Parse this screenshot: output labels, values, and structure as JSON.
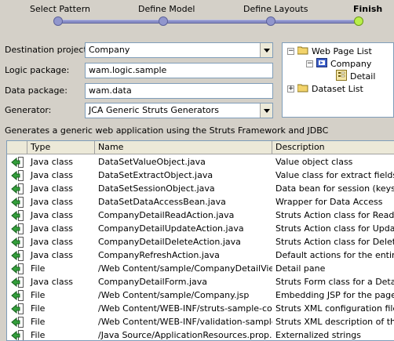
{
  "wizard": {
    "steps": [
      {
        "label": "Select Pattern"
      },
      {
        "label": "Define Model"
      },
      {
        "label": "Define Layouts"
      },
      {
        "label": "Finish"
      }
    ]
  },
  "form": {
    "destination_label": "Destination project:",
    "destination_value": "Company",
    "logic_label": "Logic package:",
    "logic_value": "wam.logic.sample",
    "data_label": "Data package:",
    "data_value": "wam.data",
    "generator_label": "Generator:",
    "generator_value": "JCA Generic Struts Generators"
  },
  "tree": {
    "items": [
      {
        "label": "Web Page List",
        "expander": "−"
      },
      {
        "label": "Company",
        "expander": "−"
      },
      {
        "label": "Detail",
        "expander": ""
      },
      {
        "label": "Dataset List",
        "expander": "+"
      }
    ]
  },
  "description": "Generates a generic web application using the Struts Framework and JDBC",
  "table": {
    "headers": [
      "Type",
      "Name",
      "Description"
    ],
    "rows": [
      {
        "type": "Java class",
        "name": "DataSetValueObject.java",
        "desc": "Value object class"
      },
      {
        "type": "Java class",
        "name": "DataSetExtractObject.java",
        "desc": "Value class for extract fields"
      },
      {
        "type": "Java class",
        "name": "DataSetSessionObject.java",
        "desc": "Data bean for session (keys)"
      },
      {
        "type": "Java class",
        "name": "DataSetDataAccessBean.java",
        "desc": "Wrapper for Data Access"
      },
      {
        "type": "Java class",
        "name": "CompanyDetailReadAction.java",
        "desc": "Struts Action class for Read"
      },
      {
        "type": "Java class",
        "name": "CompanyDetailUpdateAction.java",
        "desc": "Struts Action class for Update"
      },
      {
        "type": "Java class",
        "name": "CompanyDetailDeleteAction.java",
        "desc": "Struts Action class for Delete"
      },
      {
        "type": "Java class",
        "name": "CompanyRefreshAction.java",
        "desc": "Default actions for the entire pa"
      },
      {
        "type": "File",
        "name": "/Web Content/sample/CompanyDetailView...",
        "desc": "Detail pane"
      },
      {
        "type": "Java class",
        "name": "CompanyDetailForm.java",
        "desc": "Struts Form class for a Detail"
      },
      {
        "type": "File",
        "name": "/Web Content/sample/Company.jsp",
        "desc": "Embedding JSP for the page"
      },
      {
        "type": "File",
        "name": "/Web Content/WEB-INF/struts-sample-co...",
        "desc": "Struts XML configuration file"
      },
      {
        "type": "File",
        "name": "/Web Content/WEB-INF/validation-sample...",
        "desc": "Struts XML description of the va"
      },
      {
        "type": "File",
        "name": "/Java Source/ApplicationResources.prop...",
        "desc": "Externalized strings"
      }
    ]
  }
}
